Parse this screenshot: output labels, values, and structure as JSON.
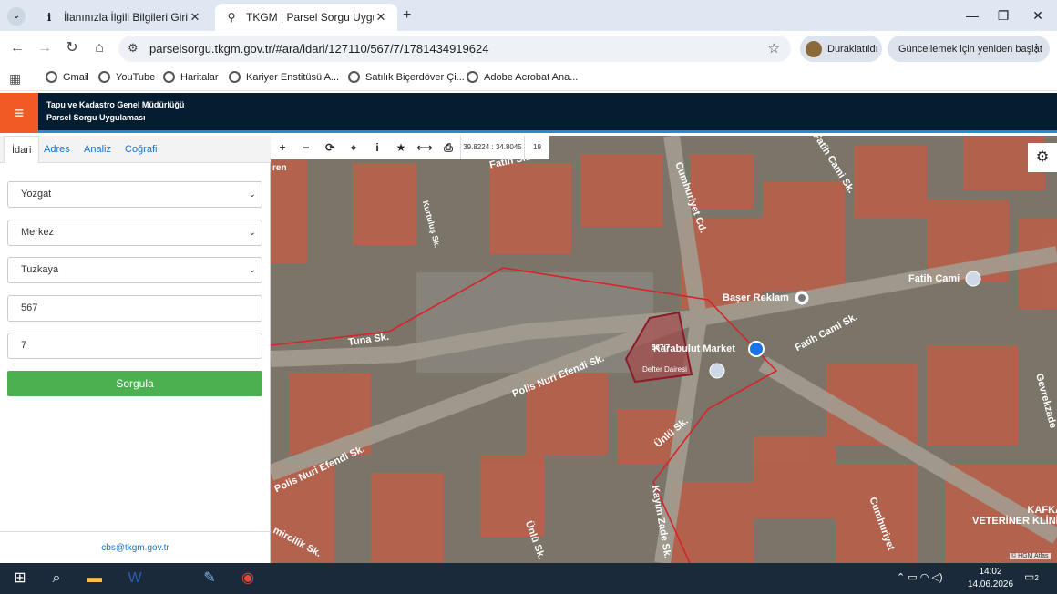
{
  "browser": {
    "tabs": [
      {
        "title": "İlanınızla İlgili Bilgileri Girin",
        "icon": "i-info-icon"
      },
      {
        "title": "TKGM | Parsel Sorgu Uygulaması",
        "icon": "location-pin-icon"
      }
    ],
    "url": "parselsorgu.tkgm.gov.tr/#ara/idari/127110/567/7/1781434919624",
    "profile_label": "Duraklatıldı",
    "update_label": "Güncellemek için yeniden başlat"
  },
  "bookmarks": [
    "Gmail",
    "YouTube",
    "Haritalar",
    "Kariyer Enstitüsü A...",
    "Satılık Biçerdöver Çi...",
    "Adobe Acrobat Ana..."
  ],
  "app": {
    "org_line1": "Tapu ve Kadastro Genel Müdürlüğü",
    "org_line2": "Parsel Sorgu Uygulaması"
  },
  "panel": {
    "tabs": [
      "İdari",
      "Adres",
      "Analiz",
      "Coğrafi"
    ],
    "province": "Yozgat",
    "district": "Merkez",
    "neighborhood": "Tuzkaya",
    "block": "567",
    "parcel": "7",
    "query_button": "Sorgula",
    "contact_email": "cbs@tkgm.gov.tr"
  },
  "map": {
    "coordinates": "39.8224 : 34.8045",
    "zoom_level": "19",
    "parcel_label": "567/7",
    "attribution": "© HGM Atlas",
    "labels": {
      "fatih_sk": "Fatih Sk.",
      "cumhuriyet_cd": "Cumhuriyet Cd.",
      "kurtulus_sk": "Kurtuluş Sk.",
      "fatih_cami_sk_top": "Fatih Cami Sk.",
      "fatih_cami": "Fatih Cami",
      "baser_reklam": "Başer Reklam",
      "tuna_sk": "Tuna Sk.",
      "karabulut_market": "Karabulut Market",
      "fatih_cami_sk": "Fatih Cami Sk.",
      "polis_nuri_efendi_sk": "Polis Nuri Efendi Sk.",
      "defter_dairesi": "Defter Dairesi",
      "unlu_sk": "Ünlü Sk.",
      "gevrekzade_sk": "Gevrekzade",
      "polis_nuri_efendi_sk2": "Polis Nuri Efendi Sk.",
      "kayimzade_sk": "Kayım Zade Sk.",
      "unlu_sk2": "Ünlü Sk.",
      "cumhuriyet_cd2": "Cumhuriyet",
      "kafkas_vet": "KAFKAS\nVETERİNER KLİNİĞİ",
      "demircilik_sk": "mircilik Sk.",
      "ren_sk": "ren"
    }
  },
  "taskbar": {
    "time": "14:02",
    "date": "14.06.2026",
    "notifications": "2"
  }
}
